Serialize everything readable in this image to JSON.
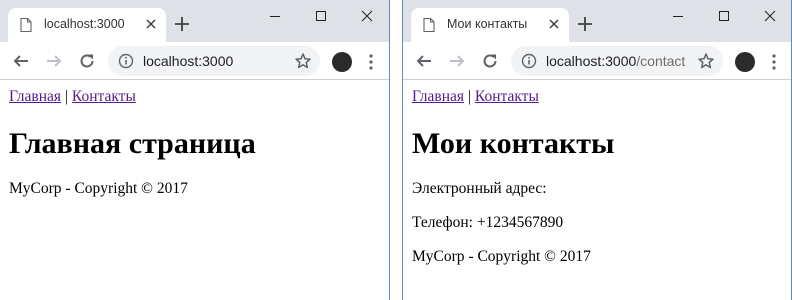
{
  "windows": [
    {
      "tab_title": "localhost:3000",
      "address_host": "localhost:3000",
      "address_path": "",
      "nav": {
        "home": "Главная",
        "separator": "|",
        "contacts": "Контакты"
      },
      "heading": "Главная страница",
      "paragraphs": [
        "MyCorp - Copyright © 2017"
      ]
    },
    {
      "tab_title": "Мои контакты",
      "address_host": "localhost:3000",
      "address_path": "/contact",
      "nav": {
        "home": "Главная",
        "separator": "|",
        "contacts": "Контакты"
      },
      "heading": "Мои контакты",
      "paragraphs": [
        "Электронный адрес:",
        "Телефон: +1234567890",
        "MyCorp - Copyright © 2017"
      ]
    }
  ],
  "icons": {
    "favicon": "page-icon",
    "close": "close-icon",
    "new_tab": "plus-icon",
    "back": "back-arrow-icon",
    "forward": "forward-arrow-icon",
    "reload": "reload-icon",
    "info": "info-icon",
    "bookmark": "star-icon",
    "profile": "avatar-icon",
    "menu": "kebab-menu-icon"
  },
  "colors": {
    "tabstrip": "#dee1e6",
    "omnibox": "#f1f3f4",
    "visited_link": "#551a8b",
    "window_border": "#5a8cc8"
  }
}
